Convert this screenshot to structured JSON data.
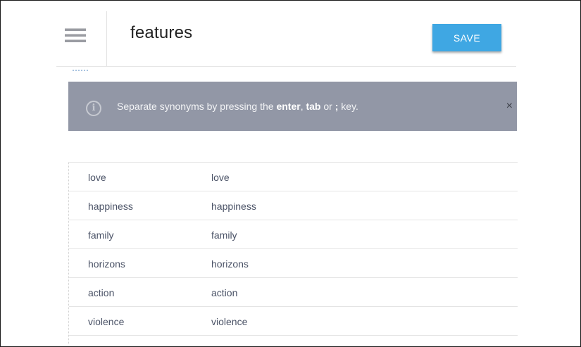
{
  "header": {
    "title": "features",
    "save_label": "SAVE"
  },
  "icons": {
    "menu": "hamburger-menu-icon",
    "info": "info-icon",
    "close": "close-icon"
  },
  "banner": {
    "text_1": "Separate synonyms by pressing the ",
    "key_1": "enter",
    "text_2": ", ",
    "key_2": "tab",
    "text_3": " or ",
    "key_3": ";",
    "text_4": " key.",
    "close_symbol": "×"
  },
  "entries": [
    {
      "value": "love",
      "synonym": "love"
    },
    {
      "value": "happiness",
      "synonym": "happiness"
    },
    {
      "value": "family",
      "synonym": "family"
    },
    {
      "value": "horizons",
      "synonym": "horizons"
    },
    {
      "value": "action",
      "synonym": "action"
    },
    {
      "value": "violence",
      "synonym": "violence"
    }
  ],
  "colors": {
    "accent": "#3fa7e3",
    "banner_bg": "#9297a6",
    "row_text": "#4a5266"
  }
}
